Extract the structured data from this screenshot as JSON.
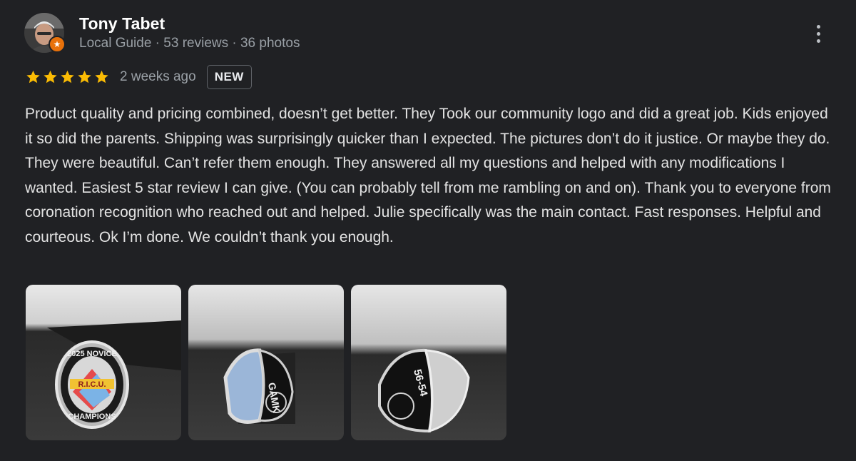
{
  "reviewer": {
    "name": "Tony Tabet",
    "meta": "Local Guide · 53 reviews · 36 photos",
    "badge_icon": "local-guide-star-icon",
    "badge_color": "#e8710a"
  },
  "rating": {
    "stars": 5,
    "max": 5,
    "star_color": "#fbbc04",
    "date": "2 weeks ago",
    "badge": "NEW"
  },
  "review": {
    "text": "Product quality and pricing combined, doesn’t get better. They Took our community logo and did a great job. Kids enjoyed it so did the parents. Shipping was surprisingly quicker than I expected. The pictures don’t do it justice. Or maybe they do. They were beautiful. Can’t refer them enough. They answered all my questions and helped with any modifications I wanted. Easiest 5 star review I can give. (You can probably tell from me rambling on and on). Thank you to everyone from coronation recognition who reached out and helped. Julie specifically was the main contact. Fast responses. Helpful and courteous. Ok I’m done. We couldn’t thank you enough."
  },
  "photos": [
    {
      "ring_top_text": "2025 NOVICE",
      "ring_center_text": "R.I.C.U.",
      "ring_bottom_text": "CHAMPIONS"
    },
    {
      "ring_side_text": "GAMK"
    },
    {
      "ring_side_text": "56-54"
    }
  ],
  "menu_icon": "more-vert-icon"
}
